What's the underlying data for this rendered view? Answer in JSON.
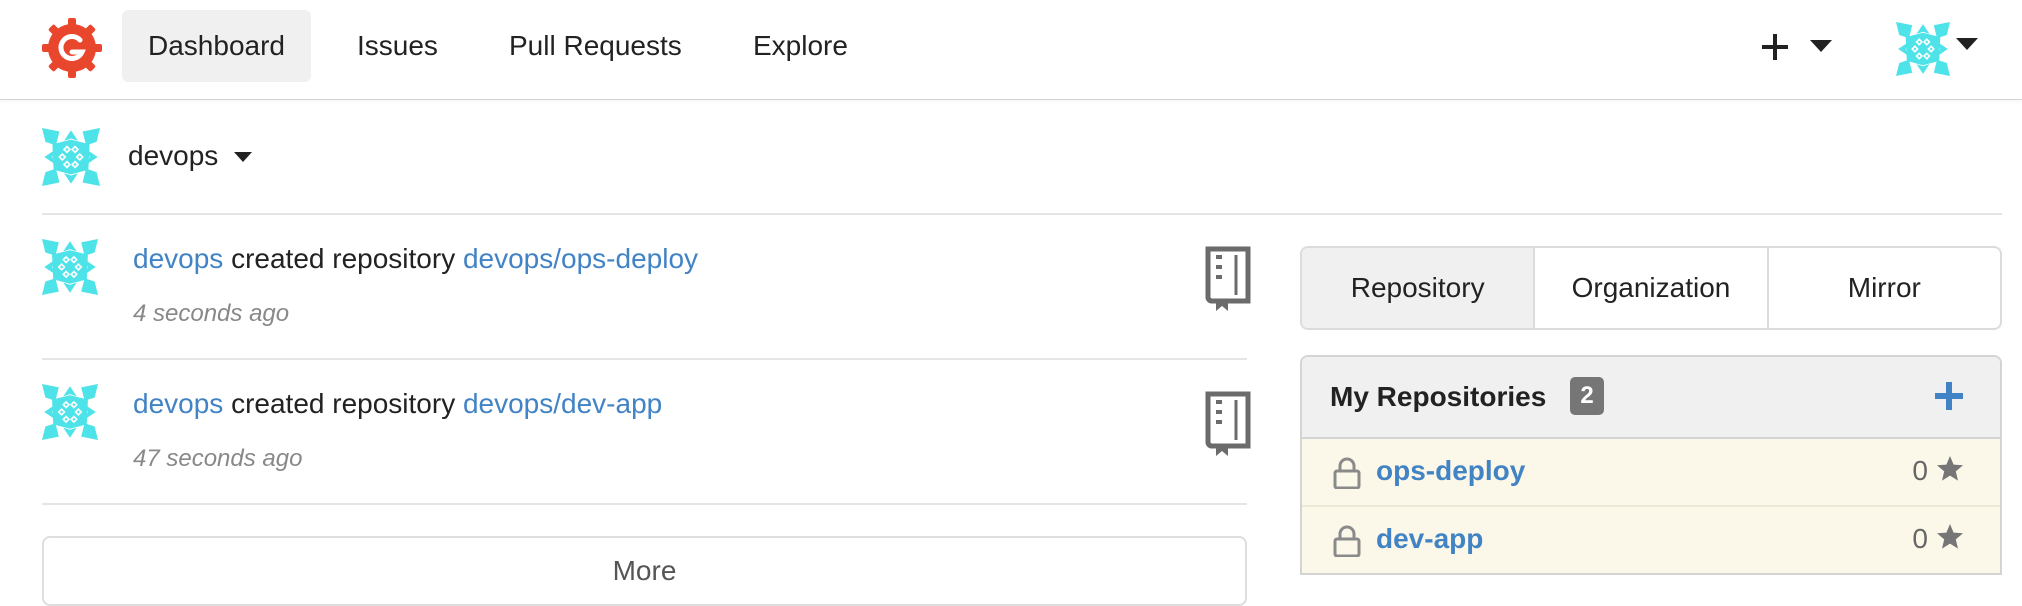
{
  "navbar": {
    "items": [
      {
        "label": "Dashboard",
        "active": true
      },
      {
        "label": "Issues"
      },
      {
        "label": "Pull Requests"
      },
      {
        "label": "Explore"
      }
    ],
    "icons": {
      "logo": "gogs-logo",
      "create": "plus-icon",
      "user_menu": "avatar-identicon"
    }
  },
  "context": {
    "name": "devops"
  },
  "feed": [
    {
      "user": "devops",
      "action": "created repository",
      "repo": "devops/ops-deploy",
      "time": "4 seconds ago"
    },
    {
      "user": "devops",
      "action": "created repository",
      "repo": "devops/dev-app",
      "time": "47 seconds ago"
    }
  ],
  "more_label": "More",
  "tabs": [
    {
      "label": "Repository",
      "active": true
    },
    {
      "label": "Organization"
    },
    {
      "label": "Mirror"
    }
  ],
  "repos": {
    "title": "My Repositories",
    "count": "2",
    "items": [
      {
        "name": "ops-deploy",
        "stars": "0",
        "private": true
      },
      {
        "name": "dev-app",
        "stars": "0",
        "private": true
      }
    ]
  },
  "colors": {
    "link": "#4183c4",
    "identicon": "#4de3e8",
    "logo": "#e8462d",
    "repo_row_bg": "#fbf8e9",
    "badge": "#767676"
  }
}
